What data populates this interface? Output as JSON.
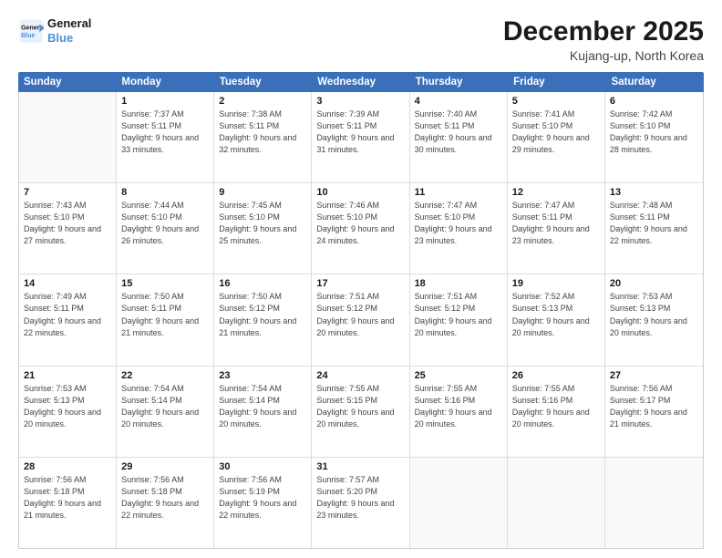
{
  "logo": {
    "line1": "General",
    "line2": "Blue"
  },
  "title": "December 2025",
  "subtitle": "Kujang-up, North Korea",
  "days": [
    "Sunday",
    "Monday",
    "Tuesday",
    "Wednesday",
    "Thursday",
    "Friday",
    "Saturday"
  ],
  "weeks": [
    [
      {
        "day": "",
        "sunrise": "",
        "sunset": "",
        "daylight": ""
      },
      {
        "day": "1",
        "sunrise": "Sunrise: 7:37 AM",
        "sunset": "Sunset: 5:11 PM",
        "daylight": "Daylight: 9 hours and 33 minutes."
      },
      {
        "day": "2",
        "sunrise": "Sunrise: 7:38 AM",
        "sunset": "Sunset: 5:11 PM",
        "daylight": "Daylight: 9 hours and 32 minutes."
      },
      {
        "day": "3",
        "sunrise": "Sunrise: 7:39 AM",
        "sunset": "Sunset: 5:11 PM",
        "daylight": "Daylight: 9 hours and 31 minutes."
      },
      {
        "day": "4",
        "sunrise": "Sunrise: 7:40 AM",
        "sunset": "Sunset: 5:11 PM",
        "daylight": "Daylight: 9 hours and 30 minutes."
      },
      {
        "day": "5",
        "sunrise": "Sunrise: 7:41 AM",
        "sunset": "Sunset: 5:10 PM",
        "daylight": "Daylight: 9 hours and 29 minutes."
      },
      {
        "day": "6",
        "sunrise": "Sunrise: 7:42 AM",
        "sunset": "Sunset: 5:10 PM",
        "daylight": "Daylight: 9 hours and 28 minutes."
      }
    ],
    [
      {
        "day": "7",
        "sunrise": "Sunrise: 7:43 AM",
        "sunset": "Sunset: 5:10 PM",
        "daylight": "Daylight: 9 hours and 27 minutes."
      },
      {
        "day": "8",
        "sunrise": "Sunrise: 7:44 AM",
        "sunset": "Sunset: 5:10 PM",
        "daylight": "Daylight: 9 hours and 26 minutes."
      },
      {
        "day": "9",
        "sunrise": "Sunrise: 7:45 AM",
        "sunset": "Sunset: 5:10 PM",
        "daylight": "Daylight: 9 hours and 25 minutes."
      },
      {
        "day": "10",
        "sunrise": "Sunrise: 7:46 AM",
        "sunset": "Sunset: 5:10 PM",
        "daylight": "Daylight: 9 hours and 24 minutes."
      },
      {
        "day": "11",
        "sunrise": "Sunrise: 7:47 AM",
        "sunset": "Sunset: 5:10 PM",
        "daylight": "Daylight: 9 hours and 23 minutes."
      },
      {
        "day": "12",
        "sunrise": "Sunrise: 7:47 AM",
        "sunset": "Sunset: 5:11 PM",
        "daylight": "Daylight: 9 hours and 23 minutes."
      },
      {
        "day": "13",
        "sunrise": "Sunrise: 7:48 AM",
        "sunset": "Sunset: 5:11 PM",
        "daylight": "Daylight: 9 hours and 22 minutes."
      }
    ],
    [
      {
        "day": "14",
        "sunrise": "Sunrise: 7:49 AM",
        "sunset": "Sunset: 5:11 PM",
        "daylight": "Daylight: 9 hours and 22 minutes."
      },
      {
        "day": "15",
        "sunrise": "Sunrise: 7:50 AM",
        "sunset": "Sunset: 5:11 PM",
        "daylight": "Daylight: 9 hours and 21 minutes."
      },
      {
        "day": "16",
        "sunrise": "Sunrise: 7:50 AM",
        "sunset": "Sunset: 5:12 PM",
        "daylight": "Daylight: 9 hours and 21 minutes."
      },
      {
        "day": "17",
        "sunrise": "Sunrise: 7:51 AM",
        "sunset": "Sunset: 5:12 PM",
        "daylight": "Daylight: 9 hours and 20 minutes."
      },
      {
        "day": "18",
        "sunrise": "Sunrise: 7:51 AM",
        "sunset": "Sunset: 5:12 PM",
        "daylight": "Daylight: 9 hours and 20 minutes."
      },
      {
        "day": "19",
        "sunrise": "Sunrise: 7:52 AM",
        "sunset": "Sunset: 5:13 PM",
        "daylight": "Daylight: 9 hours and 20 minutes."
      },
      {
        "day": "20",
        "sunrise": "Sunrise: 7:53 AM",
        "sunset": "Sunset: 5:13 PM",
        "daylight": "Daylight: 9 hours and 20 minutes."
      }
    ],
    [
      {
        "day": "21",
        "sunrise": "Sunrise: 7:53 AM",
        "sunset": "Sunset: 5:13 PM",
        "daylight": "Daylight: 9 hours and 20 minutes."
      },
      {
        "day": "22",
        "sunrise": "Sunrise: 7:54 AM",
        "sunset": "Sunset: 5:14 PM",
        "daylight": "Daylight: 9 hours and 20 minutes."
      },
      {
        "day": "23",
        "sunrise": "Sunrise: 7:54 AM",
        "sunset": "Sunset: 5:14 PM",
        "daylight": "Daylight: 9 hours and 20 minutes."
      },
      {
        "day": "24",
        "sunrise": "Sunrise: 7:55 AM",
        "sunset": "Sunset: 5:15 PM",
        "daylight": "Daylight: 9 hours and 20 minutes."
      },
      {
        "day": "25",
        "sunrise": "Sunrise: 7:55 AM",
        "sunset": "Sunset: 5:16 PM",
        "daylight": "Daylight: 9 hours and 20 minutes."
      },
      {
        "day": "26",
        "sunrise": "Sunrise: 7:55 AM",
        "sunset": "Sunset: 5:16 PM",
        "daylight": "Daylight: 9 hours and 20 minutes."
      },
      {
        "day": "27",
        "sunrise": "Sunrise: 7:56 AM",
        "sunset": "Sunset: 5:17 PM",
        "daylight": "Daylight: 9 hours and 21 minutes."
      }
    ],
    [
      {
        "day": "28",
        "sunrise": "Sunrise: 7:56 AM",
        "sunset": "Sunset: 5:18 PM",
        "daylight": "Daylight: 9 hours and 21 minutes."
      },
      {
        "day": "29",
        "sunrise": "Sunrise: 7:56 AM",
        "sunset": "Sunset: 5:18 PM",
        "daylight": "Daylight: 9 hours and 22 minutes."
      },
      {
        "day": "30",
        "sunrise": "Sunrise: 7:56 AM",
        "sunset": "Sunset: 5:19 PM",
        "daylight": "Daylight: 9 hours and 22 minutes."
      },
      {
        "day": "31",
        "sunrise": "Sunrise: 7:57 AM",
        "sunset": "Sunset: 5:20 PM",
        "daylight": "Daylight: 9 hours and 23 minutes."
      },
      {
        "day": "",
        "sunrise": "",
        "sunset": "",
        "daylight": ""
      },
      {
        "day": "",
        "sunrise": "",
        "sunset": "",
        "daylight": ""
      },
      {
        "day": "",
        "sunrise": "",
        "sunset": "",
        "daylight": ""
      }
    ]
  ]
}
